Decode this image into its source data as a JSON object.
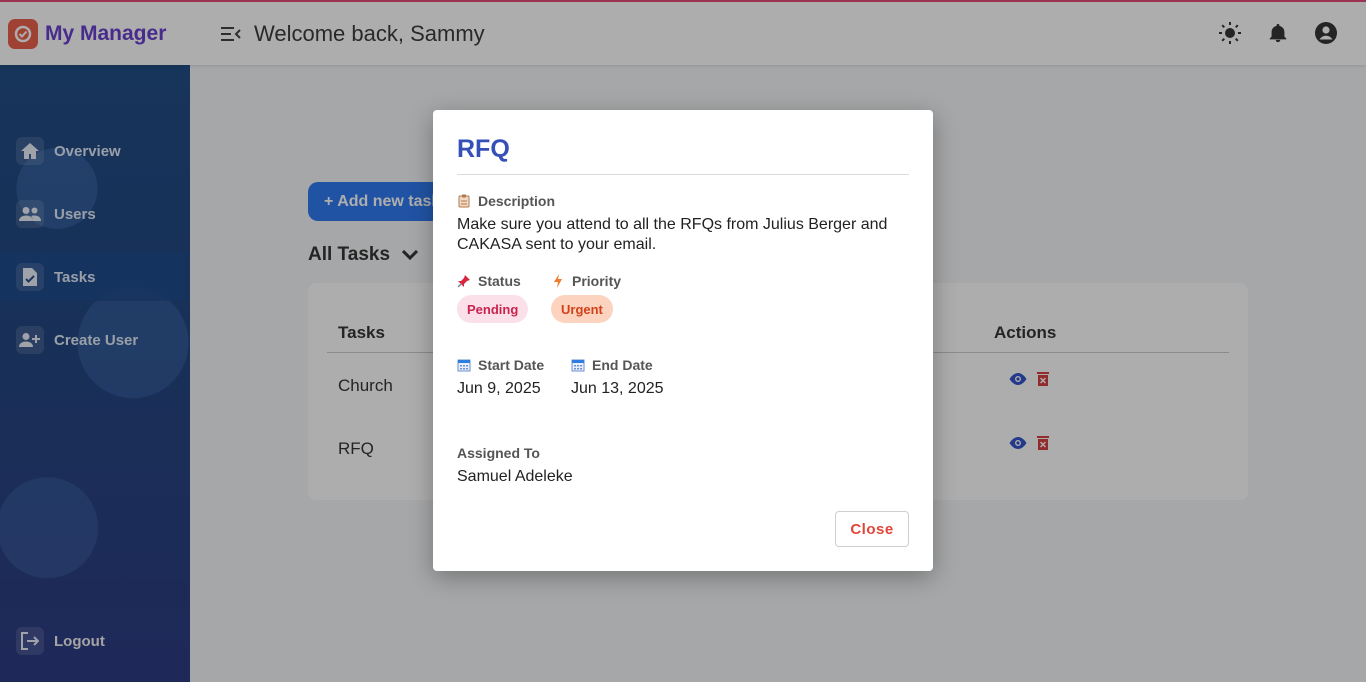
{
  "app": {
    "title": "My Manager",
    "welcome": "Welcome back, Sammy",
    "colors": {
      "brand": "#5b2fc9",
      "accent": "#1e6ff0",
      "danger": "#e0463a",
      "link": "#3550b6"
    }
  },
  "header": {
    "icons": [
      "menu-collapse-icon",
      "sun-icon",
      "bell-icon",
      "account-circle-icon"
    ]
  },
  "sidebar": {
    "items": [
      {
        "label": "Overview",
        "icon": "home-icon"
      },
      {
        "label": "Users",
        "icon": "users-icon"
      },
      {
        "label": "Tasks",
        "icon": "task-file-icon",
        "active": true
      },
      {
        "label": "Create User",
        "icon": "add-user-icon"
      }
    ],
    "logout": "Logout"
  },
  "main": {
    "add_button": "+ Add new task",
    "filter_label": "All Tasks",
    "table": {
      "headers": {
        "tasks": "Tasks",
        "actions": "Actions"
      },
      "rows": [
        {
          "task": "Church"
        },
        {
          "task": "RFQ"
        }
      ]
    }
  },
  "modal": {
    "title": "RFQ",
    "description_label": "Description",
    "description": "Make sure you attend to all the RFQs from Julius Berger and CAKASA sent to your email.",
    "status_label": "Status",
    "status": "Pending",
    "priority_label": "Priority",
    "priority": "Urgent",
    "start_label": "Start Date",
    "start_date": "Jun 9, 2025",
    "end_label": "End Date",
    "end_date": "Jun 13, 2025",
    "assigned_label": "Assigned To",
    "assigned_to": "Samuel Adeleke",
    "close_button": "Close"
  }
}
